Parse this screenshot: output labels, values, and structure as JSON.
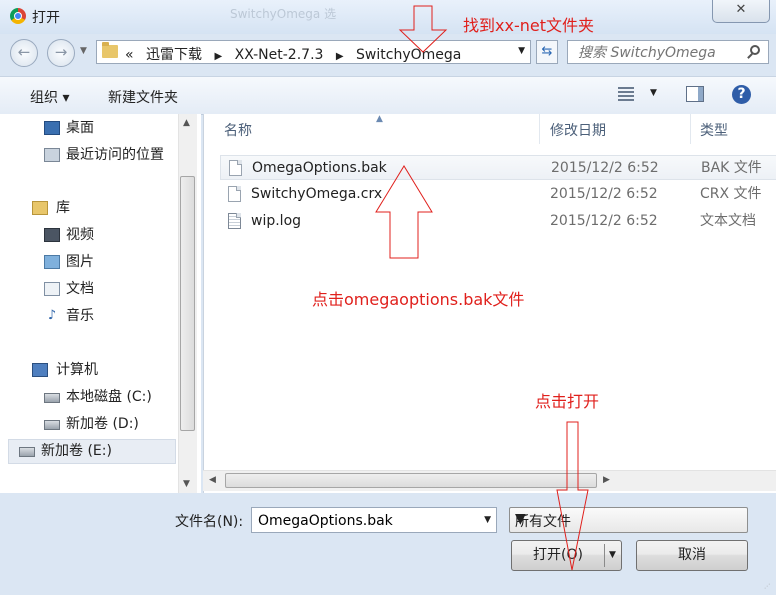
{
  "window": {
    "title": "打开",
    "background_tab": "SwitchyOmega 选",
    "close_glyph": "✕"
  },
  "address": {
    "prefix": "«",
    "crumbs": [
      "迅雷下载",
      "XX-Net-2.7.3",
      "SwitchyOmega"
    ],
    "separator": "▶"
  },
  "search": {
    "placeholder": "搜索 SwitchyOmega"
  },
  "toolbar": {
    "organize": "组织 ▾",
    "new_folder": "新建文件夹"
  },
  "nav_pane": {
    "favorites": [
      {
        "label": "桌面",
        "icon": "desktop-icon"
      },
      {
        "label": "最近访问的位置",
        "icon": "recent-places-icon"
      }
    ],
    "library": {
      "label": "库",
      "icon": "library-icon"
    },
    "library_items": [
      {
        "label": "视频",
        "icon": "video-library-icon"
      },
      {
        "label": "图片",
        "icon": "pictures-library-icon"
      },
      {
        "label": "文档",
        "icon": "documents-library-icon"
      },
      {
        "label": "音乐",
        "icon": "music-library-icon"
      }
    ],
    "computer": {
      "label": "计算机",
      "icon": "computer-icon"
    },
    "drives": [
      {
        "label": "本地磁盘 (C:)",
        "icon": "drive-icon"
      },
      {
        "label": "新加卷 (D:)",
        "icon": "drive-icon"
      },
      {
        "label": "新加卷 (E:)",
        "icon": "drive-icon",
        "selected": true
      }
    ]
  },
  "file_list": {
    "columns": {
      "name": "名称",
      "date": "修改日期",
      "type": "类型"
    },
    "files": [
      {
        "name": "OmegaOptions.bak",
        "date": "2015/12/2 6:52",
        "type": "BAK 文件",
        "selected": true
      },
      {
        "name": "SwitchyOmega.crx",
        "date": "2015/12/2 6:52",
        "type": "CRX 文件"
      },
      {
        "name": "wip.log",
        "date": "2015/12/2 6:52",
        "type": "文本文档"
      }
    ]
  },
  "bottom": {
    "filename_label": "文件名(N):",
    "filename_value": "OmegaOptions.bak",
    "filetype_value": "所有文件",
    "open_button": "打开(O)",
    "cancel_button": "取消"
  },
  "annotations": {
    "find_folder": "找到xx-net文件夹",
    "click_file": "点击omegaoptions.bak文件",
    "click_open": "点击打开",
    "color": "#e0201c"
  }
}
